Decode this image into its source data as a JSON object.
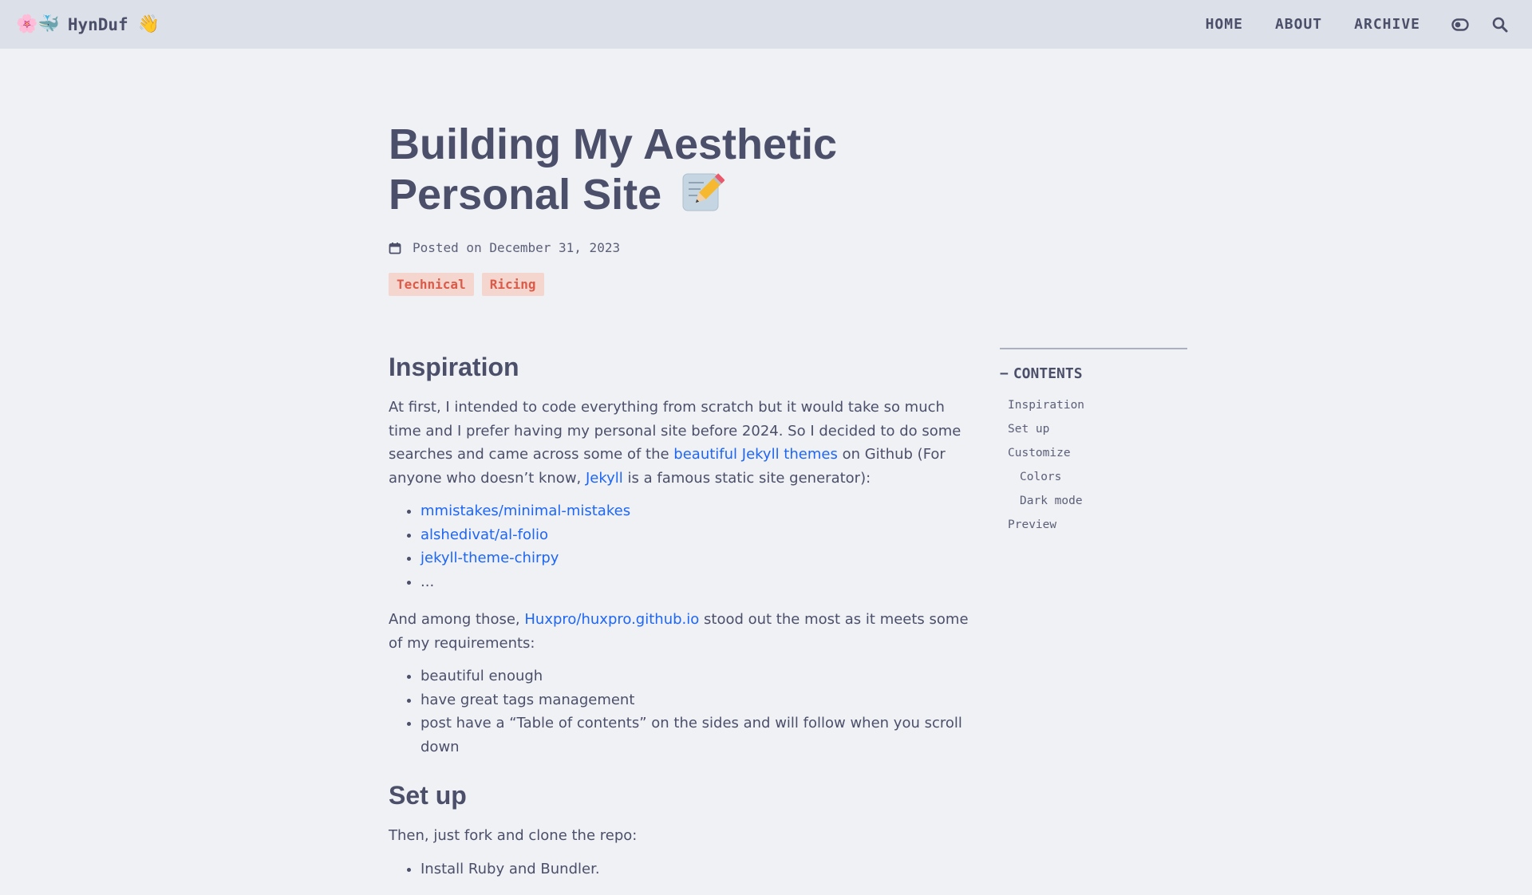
{
  "navbar": {
    "brand_name": "HynDuf",
    "brand_emoji_left": [
      "🌸",
      "🐳"
    ],
    "brand_emoji_right": "👋",
    "links": [
      "HOME",
      "ABOUT",
      "ARCHIVE"
    ],
    "theme_toggle_icon": "toggle-icon",
    "search_icon": "search-icon"
  },
  "post": {
    "title": "Building My Aesthetic Personal Site",
    "title_emoji": "memo-icon",
    "meta": "Posted on December 31, 2023",
    "tags": [
      "Technical",
      "Ricing"
    ]
  },
  "article": {
    "inspiration": {
      "heading": "Inspiration",
      "p1_before_link": "At first, I intended to code everything from scratch but it would take so much time and I prefer having my personal site before 2024. So I decided to do some searches and came across some of the ",
      "p1_link1": "beautiful Jekyll themes",
      "p1_mid": " on Github (For anyone who doesn’t know, ",
      "p1_link2": "Jekyll",
      "p1_after": " is a famous static site generator):",
      "themes": [
        "mmistakes/minimal-mistakes",
        "alshedivat/al-folio",
        "jekyll-theme-chirpy",
        "..."
      ],
      "p2_before": "And among those, ",
      "p2_link": "Huxpro/huxpro.github.io",
      "p2_after": " stood out the most as it meets some of my requirements:",
      "requirements": [
        "beautiful enough",
        "have great tags management",
        "post have a “Table of contents” on the sides and will follow when you scroll down"
      ]
    },
    "setup": {
      "heading": "Set up",
      "intro": "Then, just fork and clone the repo:",
      "steps": [
        "Install Ruby and Bundler."
      ]
    }
  },
  "toc": {
    "title": "CONTENTS",
    "toggle": "−",
    "items": [
      {
        "label": "Inspiration",
        "level": 1
      },
      {
        "label": "Set up",
        "level": 1
      },
      {
        "label": "Customize",
        "level": 1
      },
      {
        "label": "Colors",
        "level": 2
      },
      {
        "label": "Dark mode",
        "level": 2
      },
      {
        "label": "Preview",
        "level": 1
      }
    ]
  },
  "colors": {
    "background": "#eff1f5",
    "navbar": "#dce0e8",
    "text": "#4c4f69",
    "link": "#1e66f5",
    "tag_bg": "#f4d6cf",
    "tag_text": "#dc5a48"
  }
}
